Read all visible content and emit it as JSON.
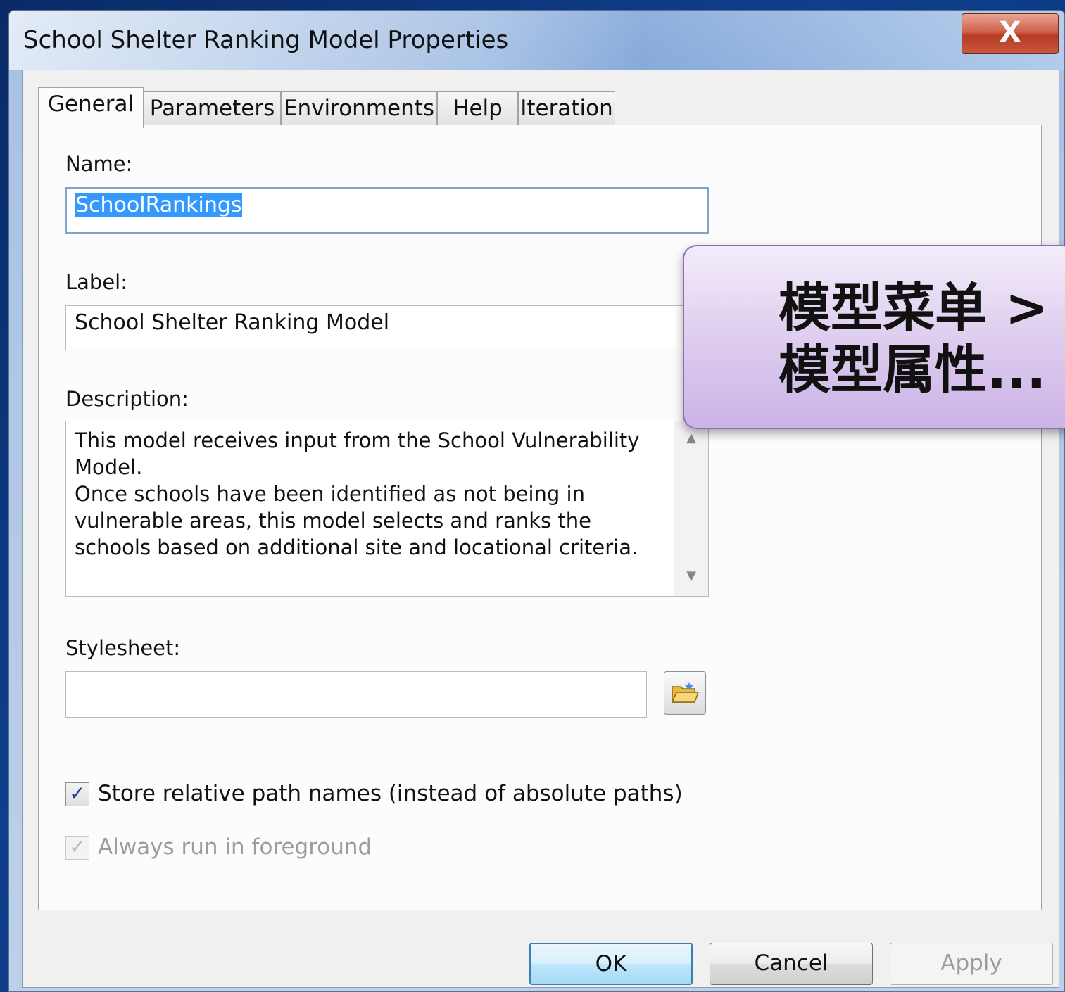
{
  "window": {
    "title": "School Shelter Ranking Model Properties",
    "close_label": "X"
  },
  "tabs": [
    {
      "label": "General",
      "active": true
    },
    {
      "label": "Parameters",
      "active": false
    },
    {
      "label": "Environments",
      "active": false
    },
    {
      "label": "Help",
      "active": false
    },
    {
      "label": "Iteration",
      "active": false
    }
  ],
  "form": {
    "name_label": "Name:",
    "name_value": "SchoolRankings",
    "label_label": "Label:",
    "label_value": "School Shelter Ranking Model",
    "description_label": "Description:",
    "description_value": "This model receives input from the School Vulnerability Model.\nOnce schools have been identified as not being in vulnerable areas, this model selects and ranks the schools based on additional site and locational criteria.",
    "stylesheet_label": "Stylesheet:",
    "stylesheet_value": "",
    "store_relative_label": "Store relative path names (instead of absolute paths)",
    "store_relative_checked": true,
    "always_foreground_label": "Always run in foreground",
    "always_foreground_checked": true,
    "always_foreground_enabled": false
  },
  "buttons": {
    "ok": "OK",
    "cancel": "Cancel",
    "apply": "Apply"
  },
  "callout": {
    "text": "模型菜单 >\n模型属性..."
  },
  "colors": {
    "selection": "#3399ff",
    "close_button": "#c7482f",
    "callout_bg": "#dccbee"
  }
}
